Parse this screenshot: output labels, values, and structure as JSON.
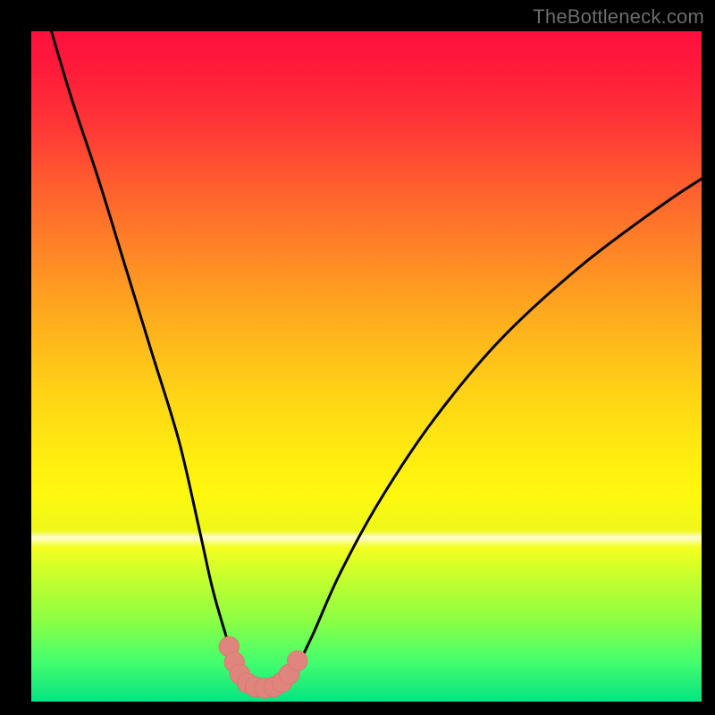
{
  "watermark": "TheBottleneck.com",
  "colors": {
    "frame": "#000000",
    "curve": "#000000",
    "marker_fill": "#e0857d",
    "marker_stroke": "#d9746a"
  },
  "chart_data": {
    "type": "line",
    "title": "",
    "xlabel": "",
    "ylabel": "",
    "xlim": [
      0,
      100
    ],
    "ylim": [
      0,
      100
    ],
    "grid": false,
    "legend": false,
    "note": "Values are read off pixel positions of the visible curve; no numeric axes are shown so x and y are normalized 0–100. Higher y = higher on the chart.",
    "series": [
      {
        "name": "bottleneck-curve",
        "x": [
          3,
          6,
          10,
          14,
          18,
          22,
          25,
          27,
          29,
          30.5,
          32,
          33.5,
          35,
          36.5,
          38,
          39.5,
          42,
          46,
          52,
          60,
          70,
          82,
          94,
          100
        ],
        "y": [
          100,
          90,
          78,
          65,
          52,
          39,
          26,
          17,
          10,
          5.5,
          3.2,
          2.3,
          2.0,
          2.3,
          3.2,
          5.0,
          10,
          19,
          30,
          42,
          54,
          65,
          74,
          78
        ]
      }
    ],
    "markers": [
      {
        "x": 29.5,
        "y": 8.2
      },
      {
        "x": 30.3,
        "y": 5.9
      },
      {
        "x": 31.1,
        "y": 4.1
      },
      {
        "x": 32.2,
        "y": 2.8
      },
      {
        "x": 33.4,
        "y": 2.2
      },
      {
        "x": 34.8,
        "y": 2.0
      },
      {
        "x": 36.2,
        "y": 2.2
      },
      {
        "x": 37.4,
        "y": 2.9
      },
      {
        "x": 38.5,
        "y": 4.1
      },
      {
        "x": 39.7,
        "y": 6.1
      }
    ],
    "marker_radius": 1.5
  }
}
